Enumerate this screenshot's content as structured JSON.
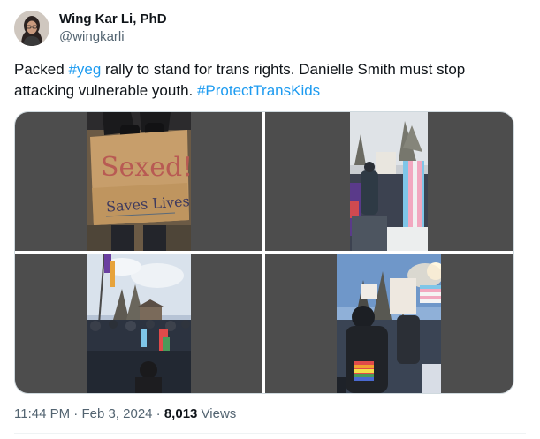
{
  "author": {
    "name": "Wing Kar Li, PhD",
    "handle": "@wingkarli"
  },
  "post": {
    "text_1": "Packed ",
    "hashtag_1": "#yeg",
    "text_2": " rally to stand for trans rights. Danielle Smith must stop attacking vulnerable youth. ",
    "hashtag_2": "#ProtectTransKids"
  },
  "media": {
    "photo_1": {
      "sign_line_1": "Sexed!",
      "sign_line_2": "Saves Lives"
    }
  },
  "meta": {
    "time": "11:44 PM",
    "sep_1": " · ",
    "date": "Feb 3, 2024",
    "sep_2": " · ",
    "views_count": "8,013",
    "views_label": " Views"
  }
}
